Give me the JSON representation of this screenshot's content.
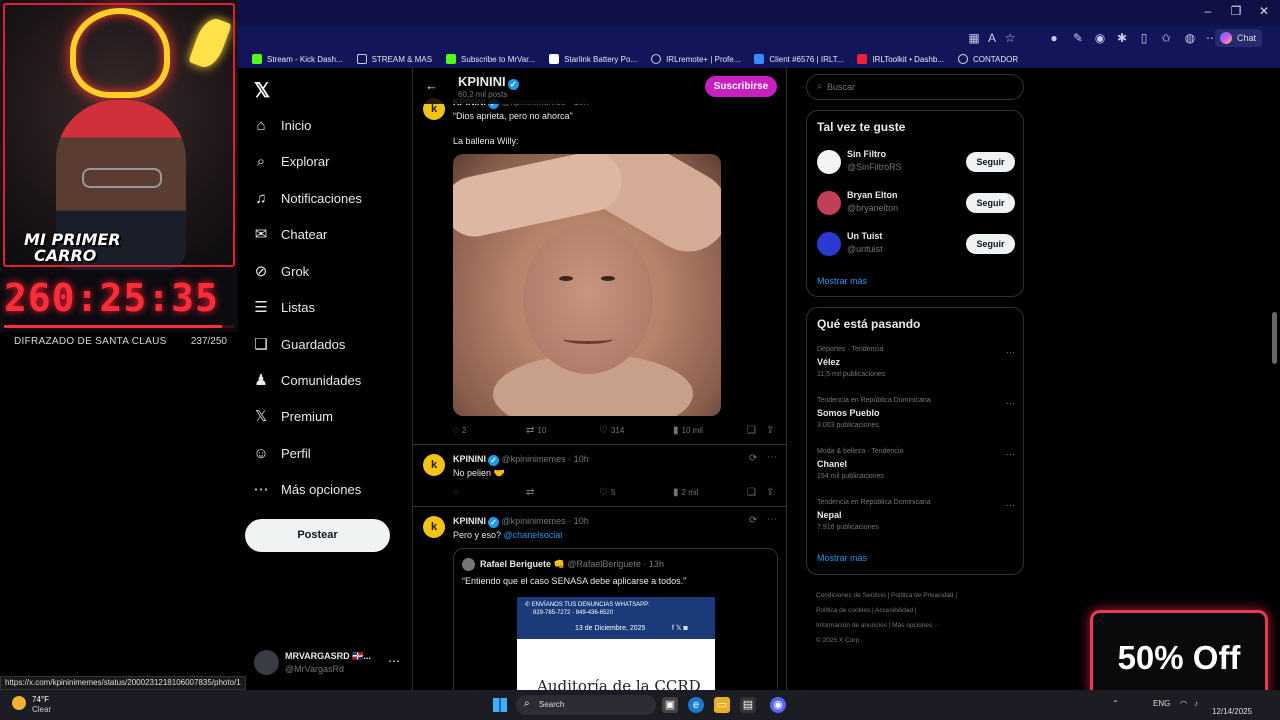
{
  "browser": {
    "toolbar_chat": "Chat",
    "bookmarks": [
      {
        "label": "Stream - Kick Dash...",
        "color": "#53fc18"
      },
      {
        "label": "STREAM & MAS",
        "color": "#c8cbe8"
      },
      {
        "label": "Subscribe to MrVar...",
        "color": "#53fc18"
      },
      {
        "label": "Starlink Battery Po...",
        "color": "#ffffff"
      },
      {
        "label": "IRLremote+ | Profe...",
        "color": "#c8cbe8"
      },
      {
        "label": "Client #6576 | IRLT...",
        "color": "#3a8cff"
      },
      {
        "label": "IRLToolkit • Dashb...",
        "color": "#e23"
      },
      {
        "label": "CONTADOR",
        "color": "#ddd"
      }
    ]
  },
  "overlay": {
    "car_text_line1": "MI PRIMER",
    "car_text_line2": "CARRO",
    "timer": "260:25:35",
    "goal_label": "DIFRAZADO DE SANTA CLAUS",
    "goal_count": "237/250",
    "goal_progress": 0.948,
    "timer_color": "#ff2d3a"
  },
  "nav": {
    "logo": "𝕏",
    "items": [
      {
        "label": "Inicio",
        "icon": "home-icon",
        "glyph": "⌂"
      },
      {
        "label": "Explorar",
        "icon": "search-icon",
        "glyph": "⌕"
      },
      {
        "label": "Notificaciones",
        "icon": "bell-icon",
        "glyph": "♫"
      },
      {
        "label": "Chatear",
        "icon": "mail-icon",
        "glyph": "✉"
      },
      {
        "label": "Grok",
        "icon": "grok-icon",
        "glyph": "⊘"
      },
      {
        "label": "Listas",
        "icon": "list-icon",
        "glyph": "☰"
      },
      {
        "label": "Guardados",
        "icon": "bookmark-icon",
        "glyph": "❑"
      },
      {
        "label": "Comunidades",
        "icon": "communities-icon",
        "glyph": "♟"
      },
      {
        "label": "Premium",
        "icon": "x-icon",
        "glyph": "𝕏"
      },
      {
        "label": "Perfil",
        "icon": "person-icon",
        "glyph": "☺"
      },
      {
        "label": "Más opciones",
        "icon": "more-circle-icon",
        "glyph": "⋯"
      }
    ],
    "post_label": "Postear",
    "profile_name": "MRVARGASRD 🇩🇴...",
    "profile_handle": "@MrVargasRd",
    "profile_more": "⋯"
  },
  "header": {
    "back": "←",
    "title": "KPININI",
    "posts": "60,2 mil posts",
    "subscribe": "Suscribirse"
  },
  "tweets": {
    "t1": {
      "name": "KPININI",
      "handle": "@kpininimemes · 10h",
      "line1": "“Dios aprieta, pero no ahorca”",
      "line2": "La ballena Willy:",
      "replies": "2",
      "retweets": "10",
      "likes": "314",
      "views": "10 mil"
    },
    "t2": {
      "name": "KPININI",
      "handle": "@kpininimemes · 10h",
      "text": "No pelien 🤝",
      "likes": "5",
      "views": "2 mil"
    },
    "t3": {
      "name": "KPININI",
      "handle": "@kpininimemes · 10h",
      "text_prefix": "Pero y eso?",
      "mention": "@chanelsocial",
      "quote_name": "Rafael Beriguete 👊",
      "quote_handle": "@RafaelBeriguete · 13h",
      "quote_text": "“Entiendo que el caso SENASA debe aplicarse a todos.”",
      "img_line1": "✆ ENVÍANOS TUS DENUNCIAS WHATSAPP:",
      "img_line2": "829-785-7272 · 849-436-6520",
      "img_date": "13 de Diciembre, 2025",
      "img_social": "f 𝕏 ◙",
      "img_headline": "Auditoría de la CCRD"
    }
  },
  "right": {
    "search_placeholder": "Buscar",
    "suggest_title": "Tal vez te guste",
    "suggestions": [
      {
        "name": "Sin Filtro",
        "handle": "@SinFiltroRS",
        "color": "#f4f4f4"
      },
      {
        "name": "Bryan Elton",
        "handle": "@bryanelton",
        "color": "#c0405a"
      },
      {
        "name": "Un Tuist",
        "handle": "@untuist",
        "color": "#2a3ad0"
      }
    ],
    "follow": "Seguir",
    "show_more": "Mostrar más",
    "trends_title": "Qué está pasando",
    "trends": [
      {
        "context": "Deportes · Tendencia",
        "topic": "Vélez",
        "posts": "11,5 mil publicaciones"
      },
      {
        "context": "Tendencia en República Dominicana",
        "topic": "Somos Pueblo",
        "posts": "3.003 publicaciones"
      },
      {
        "context": "Moda & belleza · Tendencia",
        "topic": "Chanel",
        "posts": "194 mil publicaciones"
      },
      {
        "context": "Tendencia en República Dominicana",
        "topic": "Nepal",
        "posts": "7.916 publicaciones"
      }
    ],
    "footer": [
      "Condiciones de Servicio  |  Política de Privacidad  |",
      "Política de cookies  |  Accesibilidad  |",
      "Información de anuncios  |  Más opciones ···",
      "© 2025 X Corp."
    ]
  },
  "promo": "50% Off",
  "status_url": "https://x.com/kpininimemes/status/2000231218106007835/photo/1",
  "taskbar": {
    "temp": "74°F",
    "condition": "Clear",
    "search": "Search",
    "lang": "ENG",
    "date": "12/14/2025"
  }
}
